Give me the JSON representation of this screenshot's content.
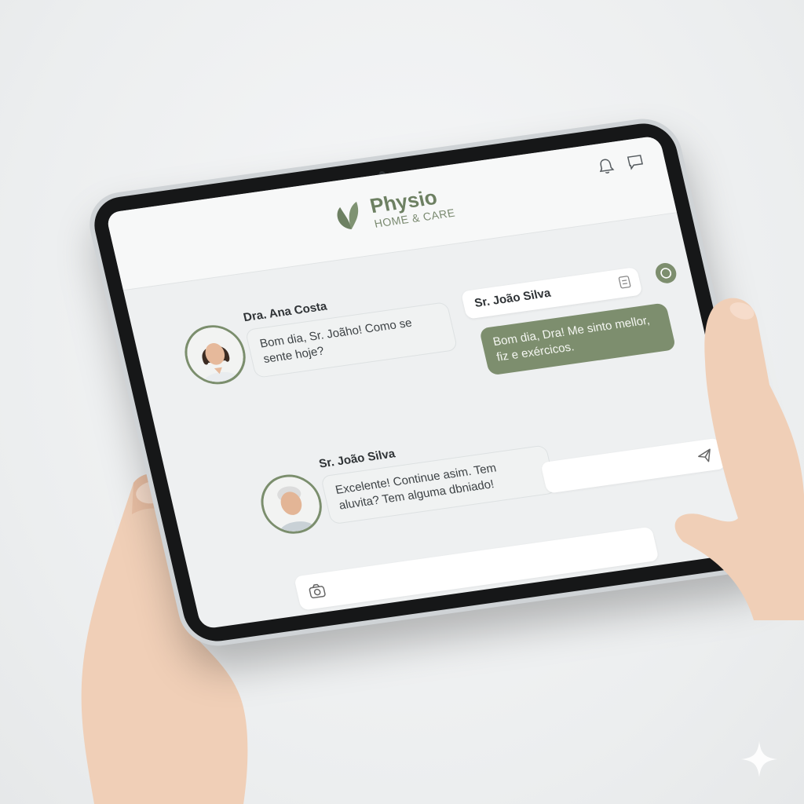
{
  "app": {
    "logo_name": "Physio",
    "logo_sub": "HOME & CARE"
  },
  "header": {
    "icons": [
      "bell-icon",
      "chat-icon"
    ]
  },
  "messages": [
    {
      "sender": "Dra. Ana Costa",
      "text": "Bom dia, Sr. Joãho! Como se sente hoje?",
      "avatar": "doctor-avatar",
      "side": "left"
    },
    {
      "sender": "Sr. João Silva",
      "text": "Bom dia, Dra! Me sinto mellor, fiz e exércicos.",
      "side": "right"
    },
    {
      "sender": "Sr. João Silva",
      "text": "Excelente! Continue asim. Tem aluvita? Tem alguma dbniado!",
      "avatar": "patient-avatar",
      "side": "left"
    }
  ],
  "colors": {
    "accent": "#7d8e6e",
    "logo": "#6d8062",
    "screen_bg": "#eef0f1"
  }
}
